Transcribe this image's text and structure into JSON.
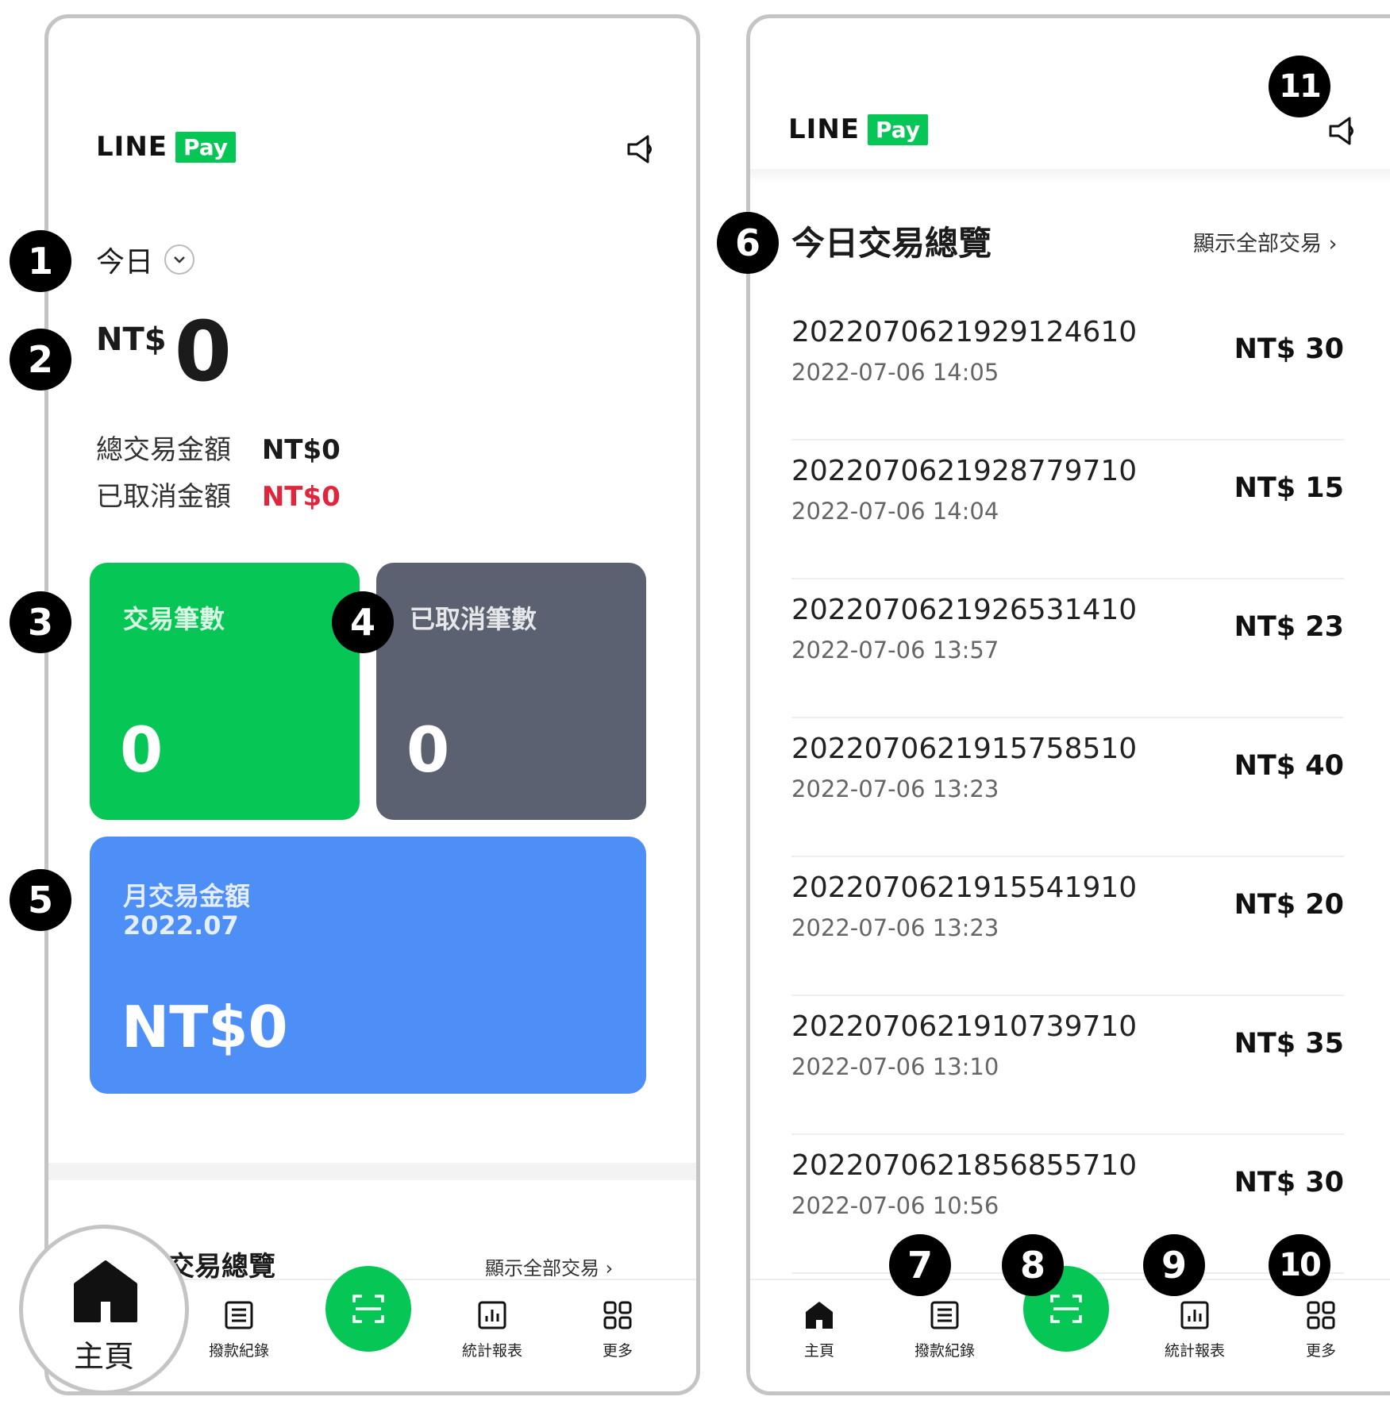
{
  "brand": {
    "line": "LINE",
    "pay": "Pay"
  },
  "colors": {
    "green": "#06c755",
    "gray": "#5b6170",
    "blue": "#4e8ef7",
    "red": "#e0263c"
  },
  "callouts": [
    "1",
    "2",
    "3",
    "4",
    "5",
    "6",
    "7",
    "8",
    "9",
    "10",
    "11"
  ],
  "left": {
    "period_label": "今日",
    "amount_currency": "NT$",
    "amount_value": "0",
    "total_label": "總交易金額",
    "total_value": "NT$0",
    "cancelled_label": "已取消金額",
    "cancelled_value": "NT$0",
    "cards": {
      "tx_count_label": "交易筆數",
      "tx_count_value": "0",
      "cancel_count_label": "已取消筆數",
      "cancel_count_value": "0",
      "monthly_label": "月交易金額",
      "monthly_period": "2022.07",
      "monthly_value": "NT$0"
    },
    "section_title_partial": "交易總覽",
    "section_link_partial": "顯示全部交易 ›",
    "home_bubble_label": "主頁"
  },
  "right": {
    "section_title": "今日交易總覽",
    "section_link": "顯示全部交易 ›",
    "transactions": [
      {
        "id": "2022070621929124610",
        "time": "2022-07-06 14:05",
        "amount": "NT$ 30"
      },
      {
        "id": "2022070621928779710",
        "time": "2022-07-06 14:04",
        "amount": "NT$ 15"
      },
      {
        "id": "2022070621926531410",
        "time": "2022-07-06 13:57",
        "amount": "NT$ 23"
      },
      {
        "id": "2022070621915758510",
        "time": "2022-07-06 13:23",
        "amount": "NT$ 40"
      },
      {
        "id": "2022070621915541910",
        "time": "2022-07-06 13:23",
        "amount": "NT$ 20"
      },
      {
        "id": "2022070621910739710",
        "time": "2022-07-06 13:10",
        "amount": "NT$ 35"
      },
      {
        "id": "2022070621856855710",
        "time": "2022-07-06 10:56",
        "amount": "NT$ 30"
      }
    ]
  },
  "tabs": {
    "home": "主頁",
    "records": "撥款紀錄",
    "stats": "統計報表",
    "more": "更多"
  }
}
